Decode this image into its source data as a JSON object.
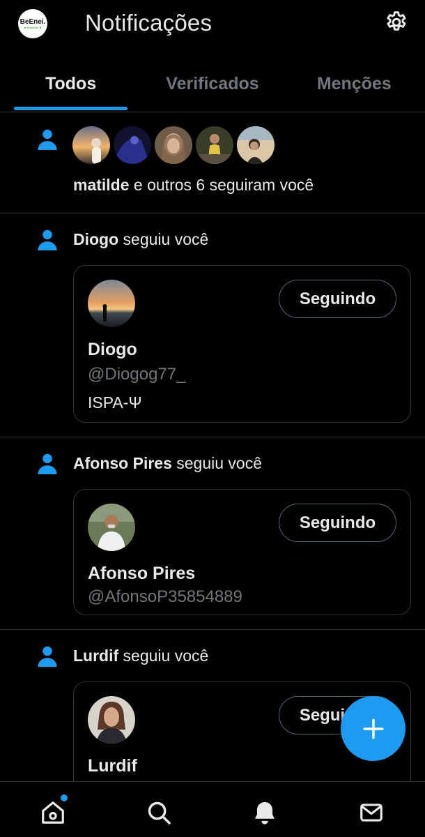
{
  "header": {
    "title": "Notificações",
    "account_brand": "BeEnei.",
    "account_sub": "★ Anúncios ★"
  },
  "tabs": [
    {
      "label": "Todos",
      "active": true
    },
    {
      "label": "Verificados",
      "active": false
    },
    {
      "label": "Menções",
      "active": false
    }
  ],
  "notifications": [
    {
      "type": "group-follow",
      "name": "matilde",
      "text": " e outros 6 seguiram você",
      "avatars": 5
    },
    {
      "type": "follow",
      "name": "Diogo",
      "text": " seguiu você",
      "card": {
        "name": "Diogo",
        "handle": "@Diogog77_",
        "bio": "ISPA-Ψ",
        "button": "Seguindo"
      }
    },
    {
      "type": "follow",
      "name": "Afonso Pires",
      "text": " seguiu você",
      "card": {
        "name": "Afonso Pires",
        "handle": "@AfonsoP35854889",
        "button": "Seguindo"
      }
    },
    {
      "type": "follow",
      "name": "Lurdif",
      "text": " seguiu você",
      "card": {
        "name": "Lurdif",
        "button": "Seguindo"
      }
    }
  ],
  "colors": {
    "accent": "#1d9bf0",
    "background": "#000000",
    "text_primary": "#e7e9ea",
    "text_secondary": "#71767b",
    "border": "#2f3336"
  },
  "icons": [
    "settings-icon",
    "person-icon",
    "plus-icon",
    "home-icon",
    "search-icon",
    "bell-icon",
    "mail-icon"
  ]
}
